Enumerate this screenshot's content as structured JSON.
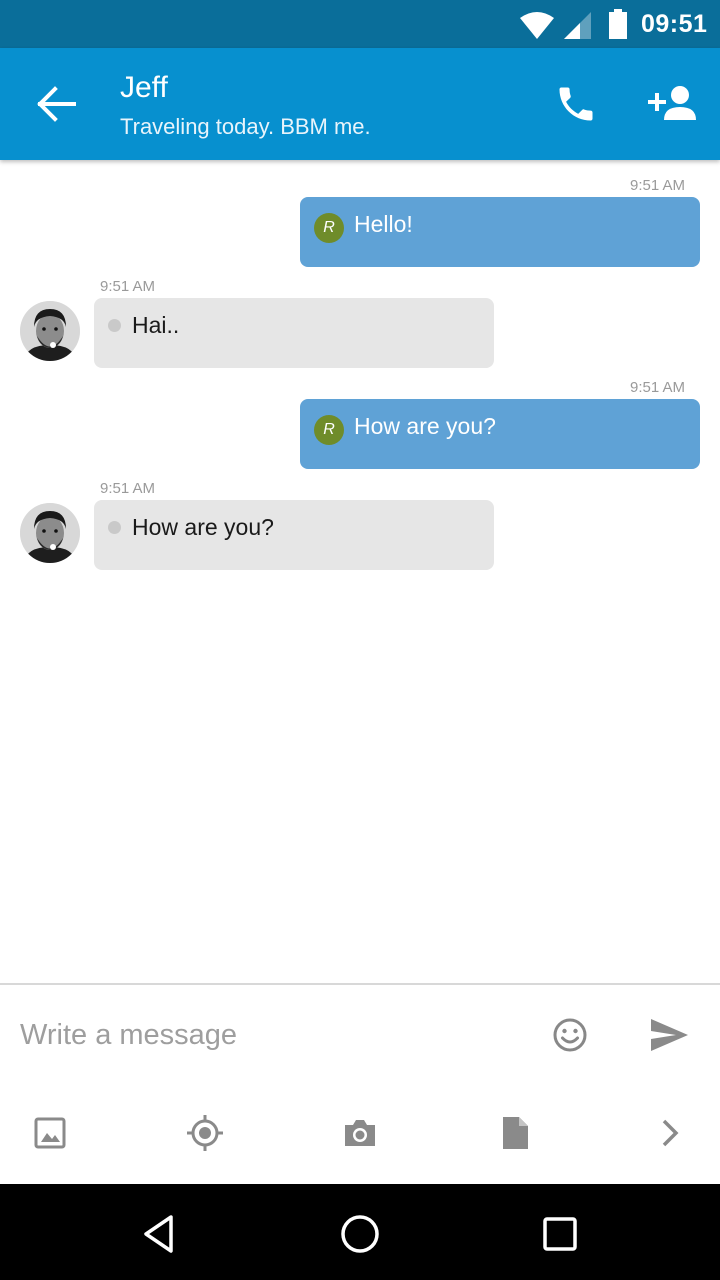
{
  "status_bar": {
    "time": "09:51",
    "icons": [
      "wifi-icon",
      "cell-signal-icon",
      "battery-icon"
    ]
  },
  "header": {
    "contact_name": "Jeff",
    "status_message": "Traveling today. BBM me.",
    "actions": [
      "back-arrow-icon",
      "phone-icon",
      "add-contact-icon"
    ],
    "color": "#0790cf"
  },
  "messages": [
    {
      "direction": "outgoing",
      "timestamp": "9:51 AM",
      "text": "Hello!",
      "badge": "R"
    },
    {
      "direction": "incoming",
      "timestamp": "9:51 AM",
      "text": "Hai.."
    },
    {
      "direction": "outgoing",
      "timestamp": "9:51 AM",
      "text": "How are you?",
      "badge": "R"
    },
    {
      "direction": "incoming",
      "timestamp": "9:51 AM",
      "text": "How are you?"
    }
  ],
  "composer": {
    "placeholder": "Write a message",
    "icons": [
      "emoji-icon",
      "send-icon"
    ],
    "attachments": [
      "image-icon",
      "location-icon",
      "camera-icon",
      "file-icon",
      "chevron-right-icon"
    ]
  },
  "nav_bar": {
    "buttons": [
      "back-triangle-icon",
      "home-circle-icon",
      "recents-square-icon"
    ]
  },
  "colors": {
    "outgoing_bubble": "#5fa2d6",
    "incoming_bubble": "#e6e6e6",
    "read_badge": "#6f8c2a",
    "status_bar": "#0a6e9a"
  }
}
